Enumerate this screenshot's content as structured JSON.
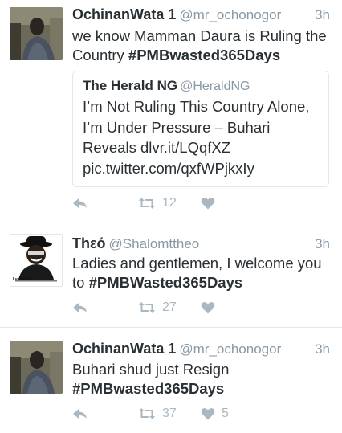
{
  "tweets": [
    {
      "name": "OchinanWata 1",
      "handle": "@mr_ochonogor",
      "time": "3h",
      "text_plain": "we know Mamman Daura is Ruling the Country ",
      "hashtag": "#PMBwasted365Days",
      "quote": {
        "name": "The Herald NG",
        "handle": "@HeraldNG",
        "text": "I’m Not Ruling This Country Alone, I’m Under Pressure – Buhari Reveals dlvr.it/LQqfXZ pic.twitter.com/qxfWPjkxIy"
      },
      "retweets": "12",
      "likes": ""
    },
    {
      "name": "Thεό",
      "handle": "@Shalomttheo",
      "time": "3h",
      "text_plain": "Ladies and gentlemen, I welcome you to ",
      "hashtag": "#PMBWasted365Days",
      "avatar_caption": "I voted for",
      "retweets": "27",
      "likes": ""
    },
    {
      "name": "OchinanWata 1",
      "handle": "@mr_ochonogor",
      "time": "3h",
      "text_plain": "Buhari shud just Resign ",
      "hashtag": "#PMBwasted365Days",
      "retweets": "37",
      "likes": "5"
    }
  ],
  "icons": {
    "reply": "reply-icon",
    "retweet": "retweet-icon",
    "like": "heart-icon"
  },
  "colors": {
    "text": "#292f33",
    "secondary": "#8899a6",
    "action": "#aab8c2",
    "divider": "#e1e8ed"
  }
}
